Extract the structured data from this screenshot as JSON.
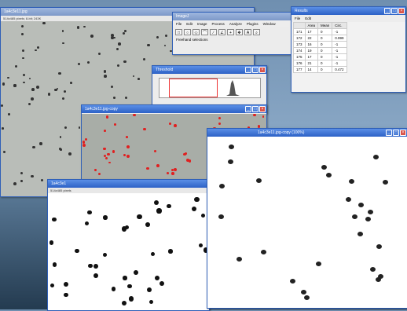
{
  "windows": {
    "original": {
      "title": "1a4c3e11.jpg",
      "info": "514x485 pixels; 8-bit; 243K"
    },
    "imagej": {
      "title": "ImageJ",
      "menu": [
        "File",
        "Edit",
        "Image",
        "Process",
        "Analyze",
        "Plugins",
        "Window"
      ],
      "tools": [
        "□",
        "○",
        "◇",
        "⌒",
        "∕",
        "∠",
        "+",
        "✥",
        "A",
        "⌕"
      ],
      "status": "Freehand selections"
    },
    "results": {
      "title": "Results",
      "menu": [
        "File",
        "Edit"
      ],
      "columns": [
        "",
        "Area",
        "Mean",
        "Circ."
      ],
      "rows": [
        [
          "171",
          "17",
          "0",
          "-1"
        ],
        [
          "172",
          "22",
          "0",
          "0.999"
        ],
        [
          "173",
          "16",
          "0",
          "-1"
        ],
        [
          "174",
          "19",
          "0",
          "-1"
        ],
        [
          "175",
          "17",
          "0",
          "-1"
        ],
        [
          "176",
          "21",
          "0",
          "-1"
        ],
        [
          "177",
          "14",
          "0",
          "0.472"
        ]
      ]
    },
    "threshold": {
      "title": "Threshold"
    },
    "copy": {
      "title": "1a4c3e11.jpg-copy"
    },
    "binary": {
      "title": "1a4c3e1",
      "info": "514x485 pixels"
    },
    "outlines": {
      "title": "1a4c3e11.jpg-copy (100%)"
    }
  },
  "colors": {
    "titlebar": "#2d62c6",
    "close": "#d9534a",
    "marker": "#e02020",
    "results_title": "#3a6fd0"
  }
}
